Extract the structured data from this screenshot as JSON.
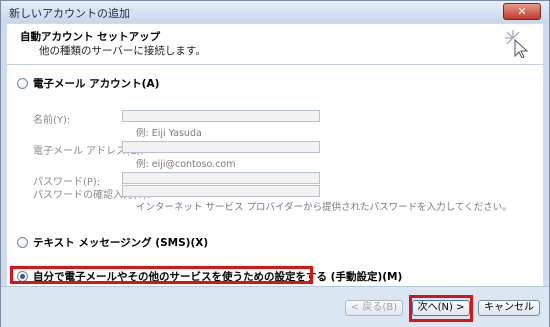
{
  "window": {
    "title": "新しいアカウントの追加",
    "close_glyph": "✕"
  },
  "header": {
    "title": "自動アカウント セットアップ",
    "subtitle": "他の種類のサーバーに接続します。"
  },
  "options": {
    "email_account": "電子メール アカウント(A)",
    "sms": "テキスト メッセージング (SMS)(X)",
    "manual": "自分で電子メールやその他のサービスを使うための設定をする (手動設定)(M)"
  },
  "email_form": {
    "name_label": "名前(Y):",
    "name_example": "例: Eiji Yasuda",
    "email_label": "電子メール アドレス(E):",
    "email_example": "例: eiji@contoso.com",
    "password_label": "パスワード(P):",
    "confirm_label": "パスワードの確認入力(T):",
    "password_hint": "インターネット サービス プロバイダーから提供されたパスワードを入力してください。"
  },
  "buttons": {
    "back": "< 戻る(B)",
    "next": "次へ(N) >",
    "cancel": "キャンセル"
  }
}
